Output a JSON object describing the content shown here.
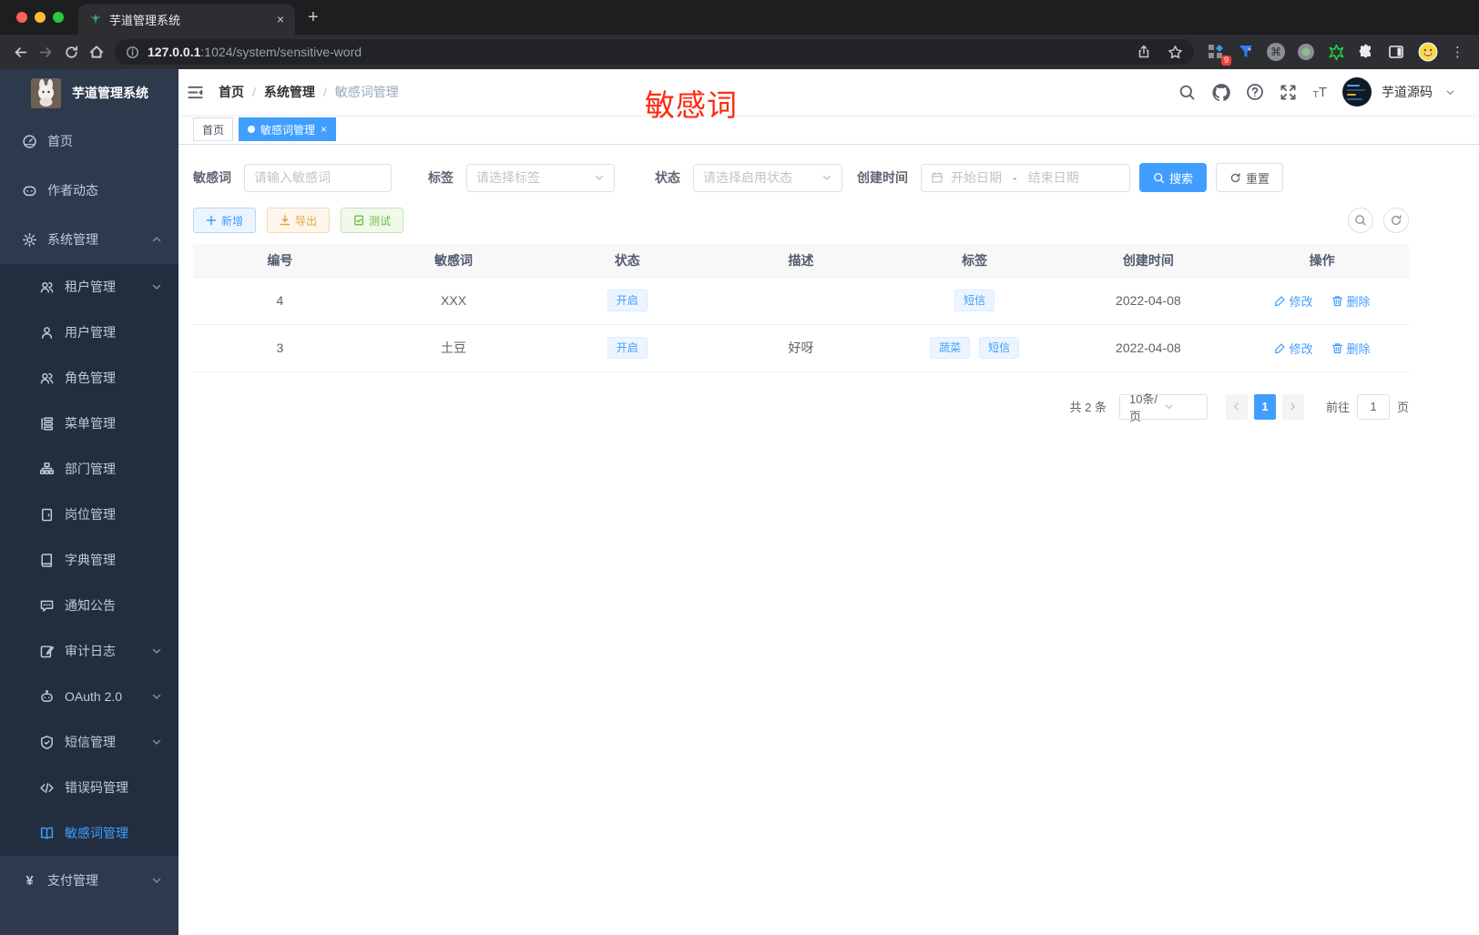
{
  "colors": {
    "accent": "#409eff",
    "warning": "#e6a23c",
    "success": "#67c23a",
    "annotation_red": "#fd2b10",
    "sidebar_bg": "#2d3a4d",
    "submenu_bg": "#222e40"
  },
  "browser": {
    "tab_title": "芋道管理系统",
    "url_host": "127.0.0.1",
    "url_path": ":1024/system/sensitive-word",
    "extension_badge": "9"
  },
  "sidebar": {
    "app_title": "芋道管理系统",
    "items_top": [
      {
        "label": "首页"
      },
      {
        "label": "作者动态"
      },
      {
        "label": "系统管理"
      }
    ],
    "system_children": [
      "租户管理",
      "用户管理",
      "角色管理",
      "菜单管理",
      "部门管理",
      "岗位管理",
      "字典管理",
      "通知公告",
      "审计日志",
      "OAuth 2.0",
      "短信管理",
      "错误码管理",
      "敏感词管理"
    ],
    "items_bottom": [
      {
        "label": "支付管理"
      }
    ],
    "active_item": "敏感词管理"
  },
  "navbar": {
    "breadcrumb": [
      "首页",
      "系统管理",
      "敏感词管理"
    ],
    "separator": "/",
    "annotation": "敏感词",
    "username": "芋道源码"
  },
  "tags_view": {
    "home": "首页",
    "active": "敏感词管理",
    "close": "×"
  },
  "filters": {
    "keyword_label": "敏感词",
    "keyword_placeholder": "请输入敏感词",
    "tag_label": "标签",
    "tag_placeholder": "请选择标签",
    "status_label": "状态",
    "status_placeholder": "请选择启用状态",
    "date_label": "创建时间",
    "date_start_placeholder": "开始日期",
    "date_separator": "-",
    "date_end_placeholder": "结束日期",
    "search_label": "搜索",
    "reset_label": "重置"
  },
  "toolbar_buttons": {
    "add_label": "新增",
    "export_label": "导出",
    "test_label": "测试"
  },
  "table": {
    "columns": [
      "编号",
      "敏感词",
      "状态",
      "描述",
      "标签",
      "创建时间",
      "操作"
    ],
    "rows": [
      {
        "id": "4",
        "word": "XXX",
        "status": "开启",
        "description": "",
        "tags": [
          "短信"
        ],
        "created_at": "2022-04-08"
      },
      {
        "id": "3",
        "word": "土豆",
        "status": "开启",
        "description": "好呀",
        "tags": [
          "蔬菜",
          "短信"
        ],
        "created_at": "2022-04-08"
      }
    ],
    "edit_label": "修改",
    "delete_label": "删除"
  },
  "pagination": {
    "total": "共 2 条",
    "page_size": "10条/页",
    "current": "1",
    "goto": "前往",
    "goto_value": "1",
    "unit": "页"
  }
}
